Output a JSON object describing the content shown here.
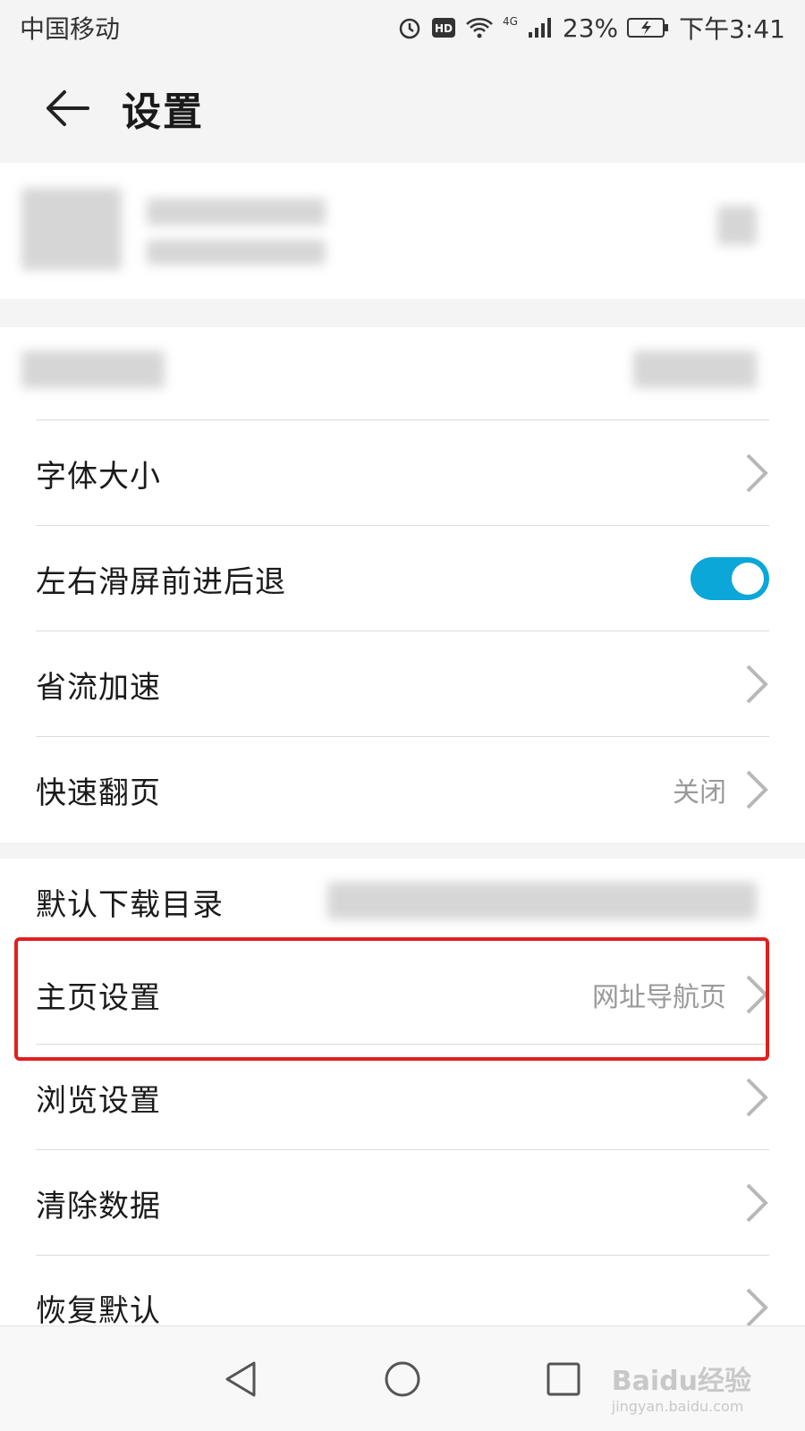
{
  "status_bar": {
    "carrier": "中国移动",
    "battery": "23%",
    "time": "下午3:41",
    "network": "4G",
    "icons": [
      "alarm-icon",
      "hd-icon",
      "wifi-icon",
      "signal-icon",
      "battery-icon"
    ]
  },
  "header": {
    "title": "设置",
    "back_icon": "back-arrow-icon"
  },
  "settings": {
    "font_size": {
      "label": "字体大小"
    },
    "swipe_nav": {
      "label": "左右滑屏前进后退",
      "enabled": true
    },
    "data_saver": {
      "label": "省流加速"
    },
    "quick_page": {
      "label": "快速翻页",
      "value": "关闭"
    },
    "download_dir": {
      "label": "默认下载目录"
    },
    "homepage": {
      "label": "主页设置",
      "value": "网址导航页"
    },
    "browse": {
      "label": "浏览设置"
    },
    "clear_data": {
      "label": "清除数据"
    },
    "restore": {
      "label": "恢复默认"
    }
  },
  "nav_bar": {
    "icons": [
      "back-triangle-icon",
      "home-circle-icon",
      "recents-square-icon"
    ]
  },
  "watermark": {
    "brand": "Baidu经验",
    "url": "jingyan.baidu.com"
  },
  "colors": {
    "accent": "#0aa7d8",
    "highlight": "#e02020",
    "background": "#f4f4f4"
  }
}
